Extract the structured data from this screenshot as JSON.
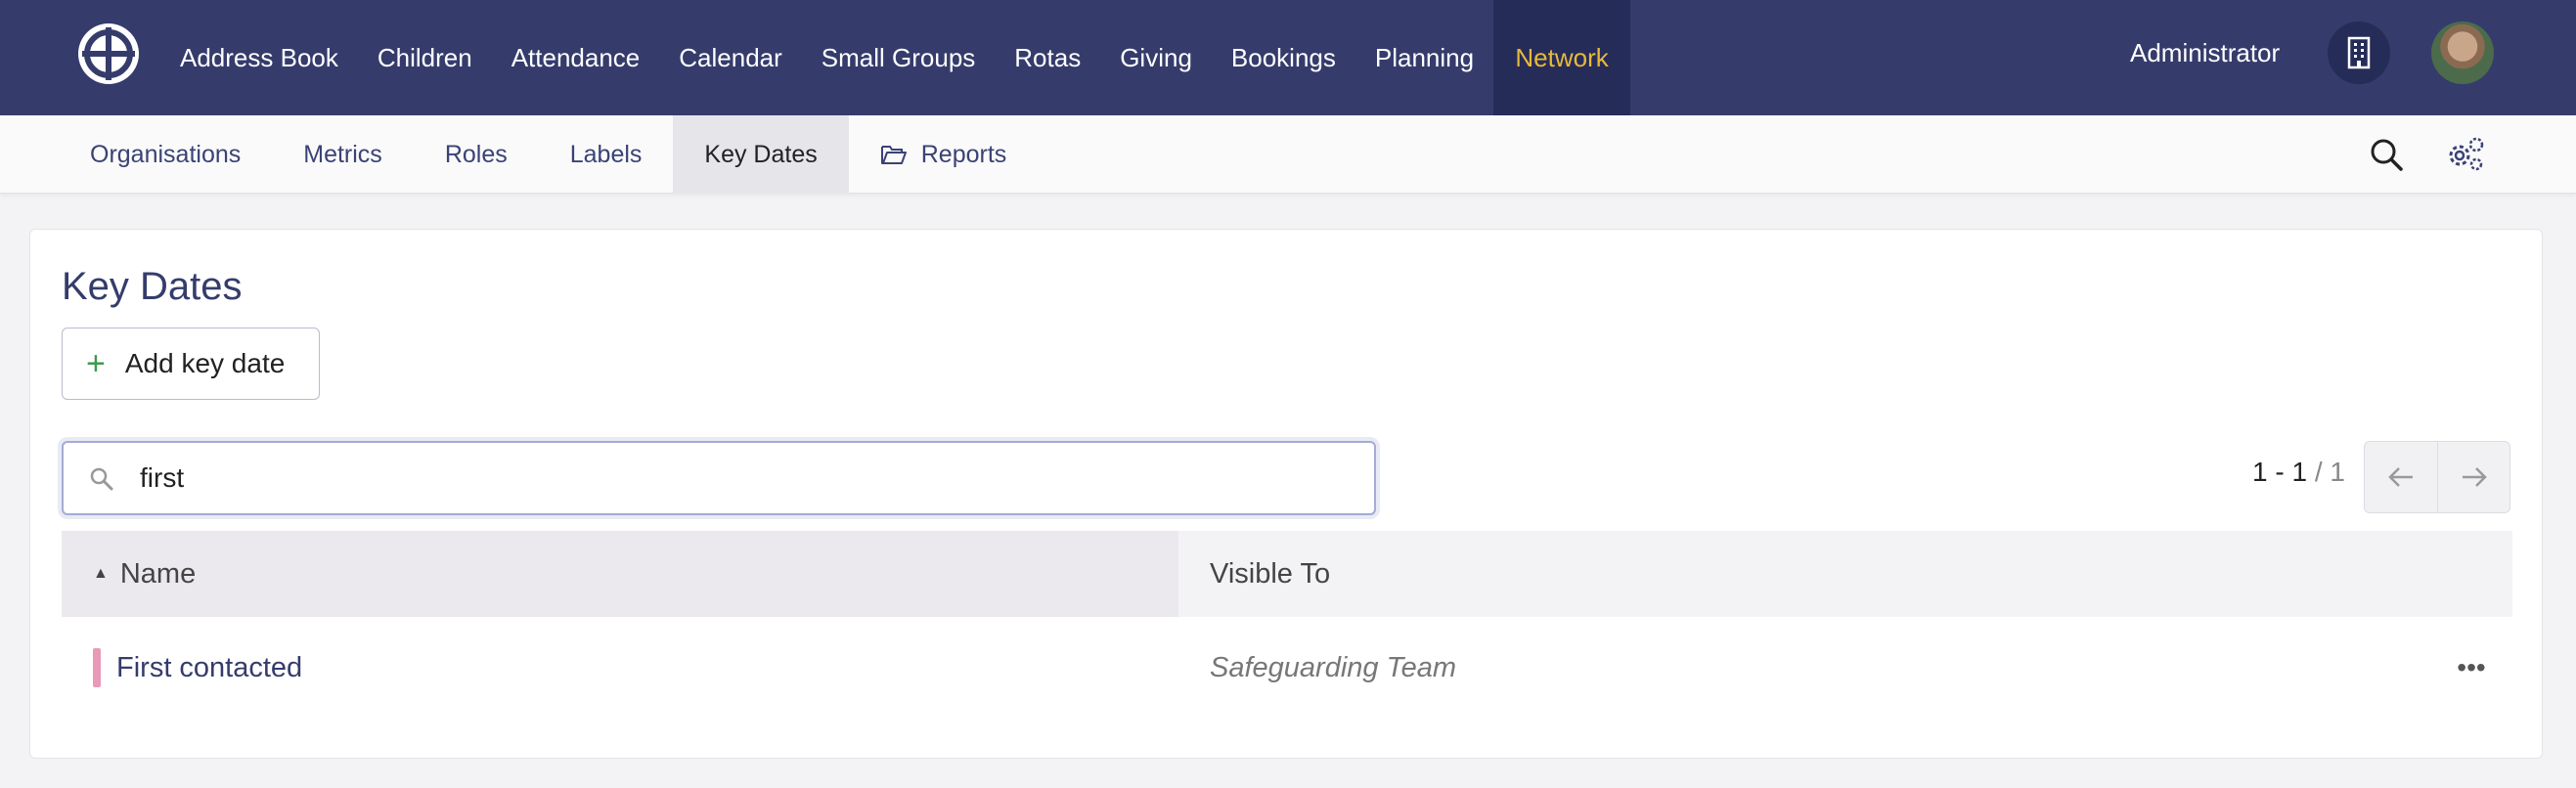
{
  "topnav": {
    "items": [
      {
        "label": "Address Book"
      },
      {
        "label": "Children"
      },
      {
        "label": "Attendance"
      },
      {
        "label": "Calendar"
      },
      {
        "label": "Small Groups"
      },
      {
        "label": "Rotas"
      },
      {
        "label": "Giving"
      },
      {
        "label": "Bookings"
      },
      {
        "label": "Planning"
      },
      {
        "label": "Network",
        "active": true
      }
    ],
    "user_label": "Administrator",
    "active_color": "#e8b93a",
    "bar_color": "#353c6c"
  },
  "subnav": {
    "items": [
      {
        "label": "Organisations"
      },
      {
        "label": "Metrics"
      },
      {
        "label": "Roles"
      },
      {
        "label": "Labels"
      },
      {
        "label": "Key Dates",
        "active": true
      },
      {
        "label": "Reports",
        "icon": "folder-open-icon"
      }
    ]
  },
  "main": {
    "title": "Key Dates",
    "add_button_label": "Add key date",
    "search": {
      "value": "first"
    },
    "pager": {
      "range": "1 - 1",
      "total": "/ 1"
    },
    "table": {
      "columns": [
        "Name",
        "Visible To"
      ],
      "rows": [
        {
          "name": "First contacted",
          "visible_to": "Safeguarding Team",
          "color": "#e89ab8"
        }
      ]
    }
  }
}
